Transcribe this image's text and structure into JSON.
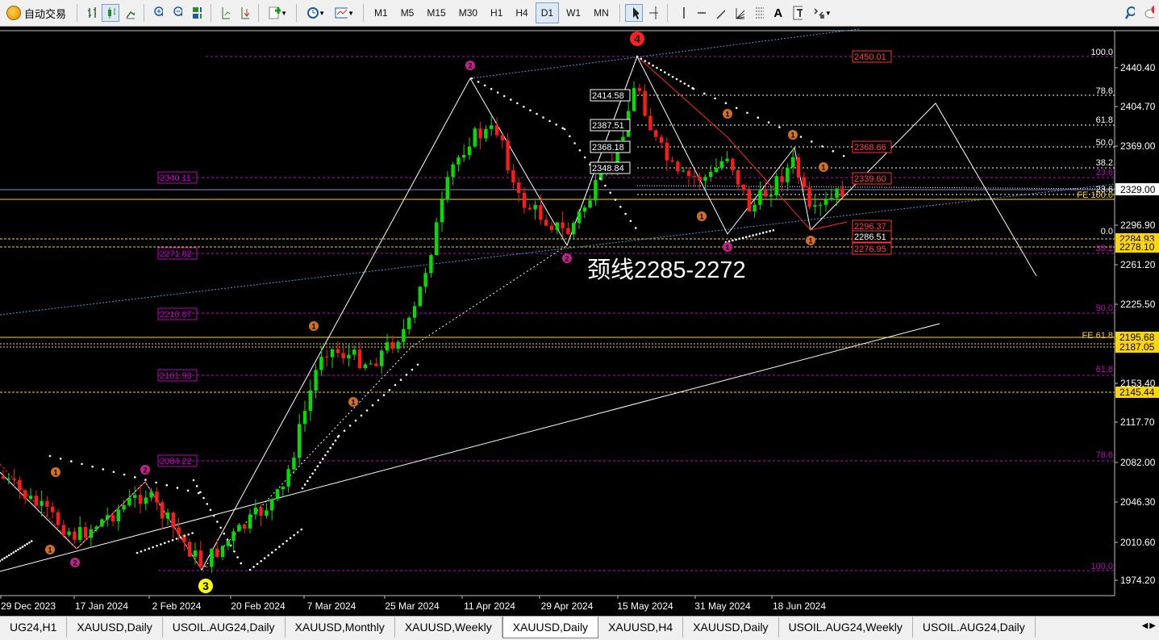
{
  "toolbar": {
    "autotrade_label": "自动交易",
    "timeframes": [
      "M1",
      "M5",
      "M15",
      "M30",
      "H1",
      "H4",
      "D1",
      "W1",
      "MN"
    ],
    "active_timeframe": "D1",
    "icons": [
      "bar-chart-icon",
      "candlestick-icon",
      "line-chart-icon",
      "zoom-in-icon",
      "zoom-out-icon",
      "tile-windows-icon",
      "chart-shift-icon",
      "autoscroll-icon",
      "indicators-icon",
      "periods-icon",
      "templates-icon",
      "cursor-icon",
      "crosshair-icon",
      "vertical-line-icon",
      "horizontal-line-icon",
      "trendline-icon",
      "fibonacci-fan-icon",
      "fibonacci-retracement-icon",
      "text-icon",
      "text-label-icon",
      "shapes-icon",
      "search-icon",
      "notifications-icon"
    ]
  },
  "annotation_text": "颈线2285-2272",
  "price_axis": {
    "labels": [
      "2440.40",
      "2404.70",
      "2369.00",
      "2329.00",
      "2296.90",
      "2261.20",
      "2225.50",
      "2189.80",
      "2153.40",
      "2117.70",
      "2082.00",
      "2046.30",
      "2010.60",
      "1974.20"
    ],
    "current_price": "2329.00",
    "highlight_labels": [
      {
        "text": "2284.93",
        "color": "#ffd700"
      },
      {
        "text": "2278.10",
        "color": "#ffd700"
      },
      {
        "text": "2195.68",
        "color": "#ffd700"
      },
      {
        "text": "2187.05",
        "color": "#ffd700"
      },
      {
        "text": "2145.44",
        "color": "#ffd700"
      }
    ]
  },
  "time_axis": [
    "29 Dec 2023",
    "17 Jan 2024",
    "2 Feb 2024",
    "20 Feb 2024",
    "7 Mar 2024",
    "25 Mar 2024",
    "11 Apr 2024",
    "29 Apr 2024",
    "15 May 2024",
    "31 May 2024",
    "18 Jun 2024"
  ],
  "level_labels": {
    "left": [
      "2340.11",
      "2271.82",
      "2216.87",
      "2161.93",
      "2084.22"
    ],
    "mid": [
      "2414.58",
      "2387.51",
      "2368.18",
      "2348.84"
    ],
    "right_red": [
      "2450.01",
      "2368.66",
      "2339.60",
      "2296.37",
      "2286.51",
      "2276.95"
    ],
    "fib_right": [
      "100.0",
      "78.6",
      "61.8",
      "50.0",
      "38.2",
      "23.6",
      "23.6",
      "FE 100.0",
      "0.0",
      "38.2",
      "50.0",
      "FE 61.8",
      "61.8",
      "78.6",
      "100.0"
    ]
  },
  "wave_markers": {
    "big": [
      "4",
      "3"
    ],
    "small": [
      "2",
      "2",
      "2",
      "2",
      "1",
      "1",
      "1",
      "1",
      "1",
      "1",
      "1",
      "1",
      "1",
      "1"
    ]
  },
  "tabs": [
    "UG24,H1",
    "XAUUSD,Daily",
    "USOIL.AUG24,Daily",
    "XAUUSD,Monthly",
    "XAUUSD,Weekly",
    "XAUUSD,Daily",
    "XAUUSD,H4",
    "XAUUSD,Daily",
    "USOIL.AUG24,Weekly",
    "USOIL.AUG24,Daily"
  ],
  "active_tab_index": 5,
  "colors": {
    "bull": "#00e000",
    "bear": "#ff1a1a",
    "fib": "#c000c0",
    "neck": "#ffd700",
    "trend": "#ffffff",
    "channel": "#3aa0e0"
  }
}
